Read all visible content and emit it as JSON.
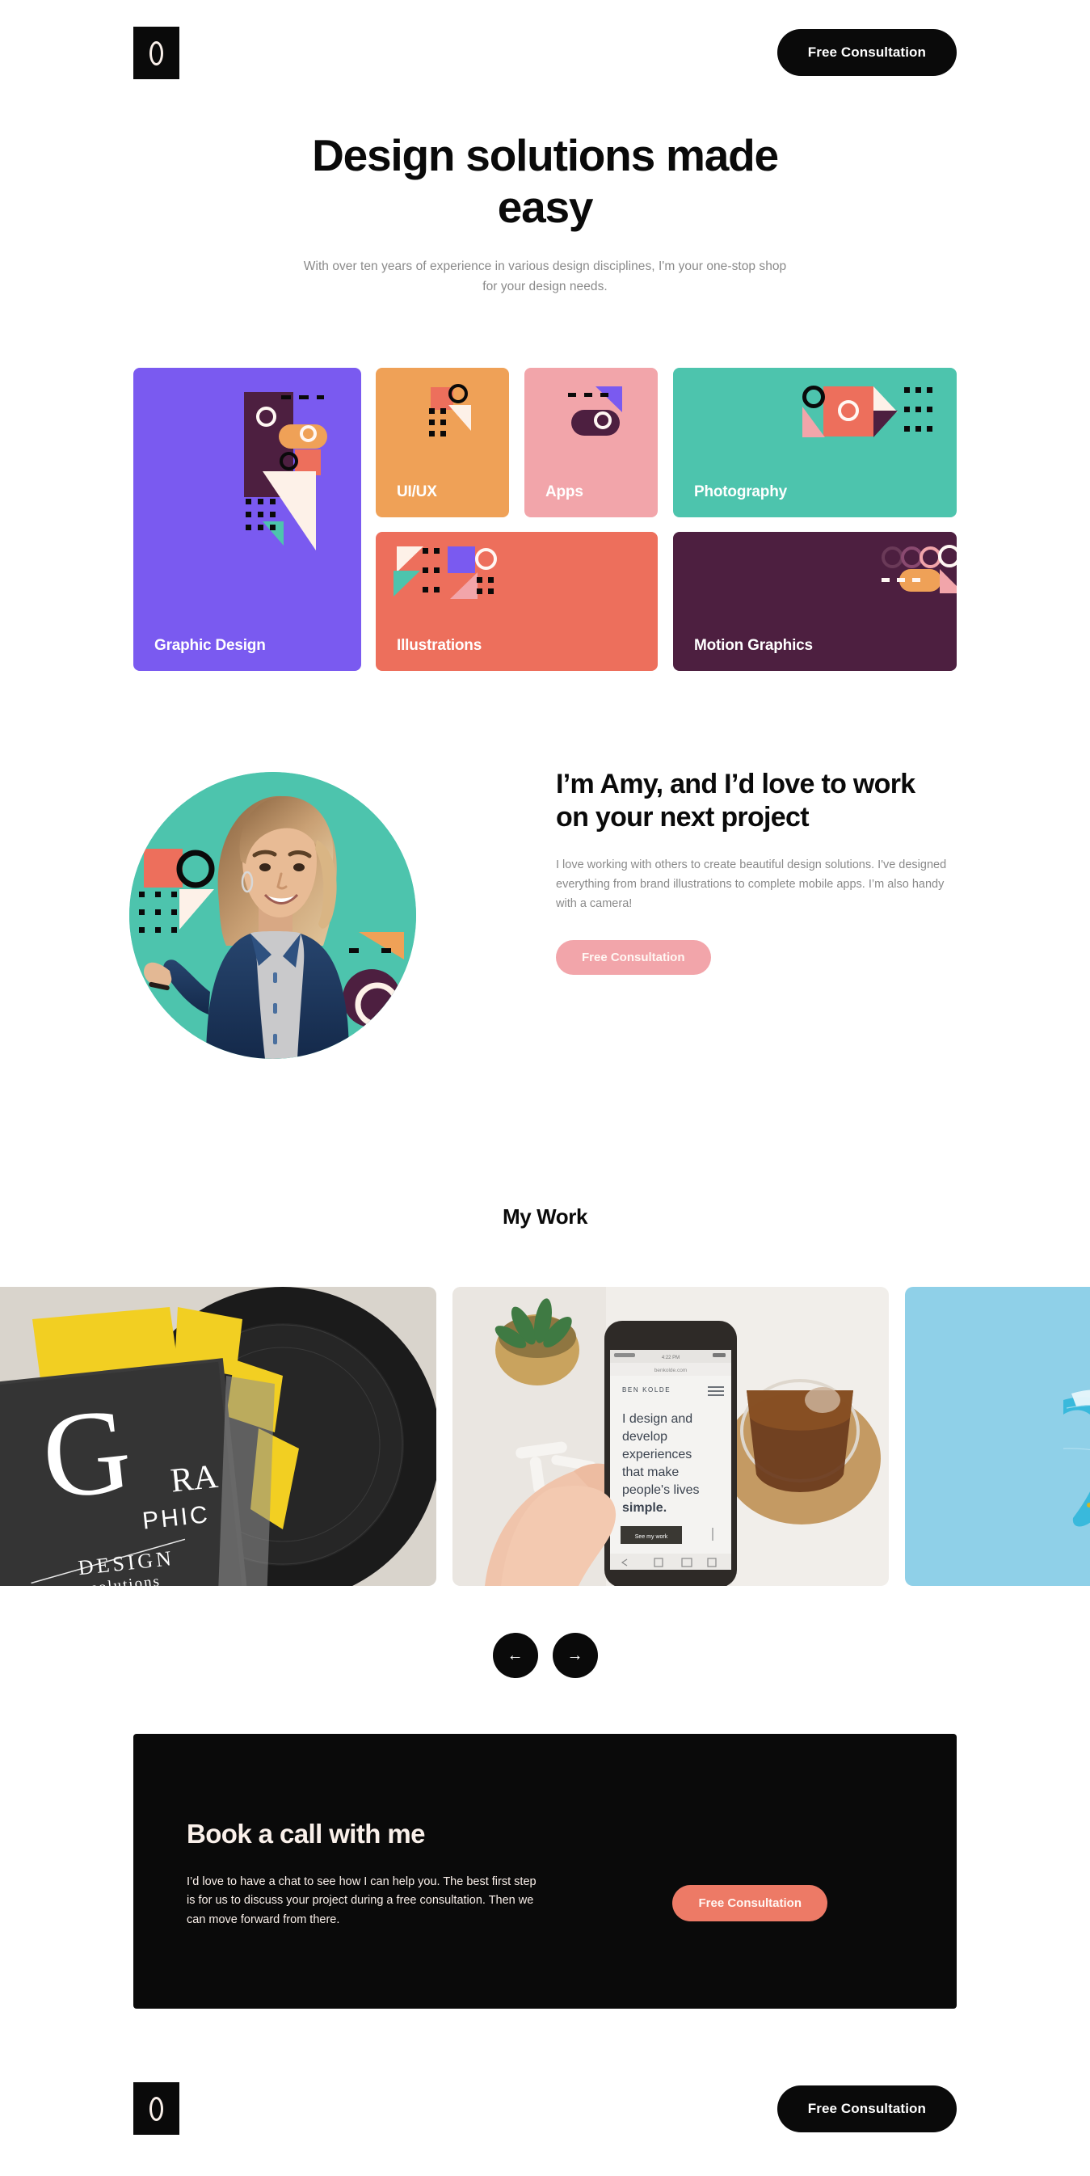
{
  "header": {
    "logo_name": "circle-monogram-logo",
    "cta_label": "Free Consultation"
  },
  "hero": {
    "title": "Design solutions made easy",
    "subtitle": "With over ten years of experience in various design disciplines, I'm your one-stop shop for your design needs."
  },
  "categories": [
    {
      "label": "Graphic Design",
      "color": "#7a5af0"
    },
    {
      "label": "UI/UX",
      "color": "#efa157"
    },
    {
      "label": "Apps",
      "color": "#f2a5aa"
    },
    {
      "label": "Photography",
      "color": "#4dc4ad"
    },
    {
      "label": "Illustrations",
      "color": "#ed6f5c"
    },
    {
      "label": "Motion Graphics",
      "color": "#4d1f40"
    }
  ],
  "about": {
    "portrait_alt": "Smiling woman in denim jacket",
    "title": "I’m Amy, and I’d love to work on your next project",
    "text": "I love working with others to create beautiful design solutions. I've designed everything from brand illustrations to complete mobile apps. I’m also handy with a camera!",
    "cta_label": "Free Consultation",
    "cta_color": "#f2a5aa"
  },
  "work": {
    "title": "My Work",
    "slides": [
      {
        "caption": "Graphic Design Solutions magazine on vinyl records"
      },
      {
        "caption": "Hand holding phone showing Ben Kolde portfolio site"
      },
      {
        "caption": "Blue translucent ribbons on light blue background"
      }
    ],
    "prev_label": "←",
    "next_label": "→"
  },
  "cta": {
    "title": "Book a call with me",
    "text": "I’d love to have a chat to see how I can help you. The best first step is for us to discuss your project during a free consultation. Then we can move forward from there.",
    "button_label": "Free Consultation",
    "bg_color": "#0a0a0a",
    "button_color": "#ed7a66"
  },
  "footer": {
    "logo_name": "circle-monogram-logo",
    "cta_label": "Free Consultation"
  },
  "phone_mock": {
    "brand": "BEN KOLDE",
    "headline_1": "I design and",
    "headline_2": "develop",
    "headline_3": "experiences",
    "headline_4": "that make",
    "headline_5": "people's lives",
    "headline_6": "simple.",
    "button": "See my work"
  },
  "magazine_mock": {
    "g": "G",
    "ra": "RA",
    "phic": "PHIC",
    "design": "DESIGN",
    "solutions": "solutions"
  }
}
